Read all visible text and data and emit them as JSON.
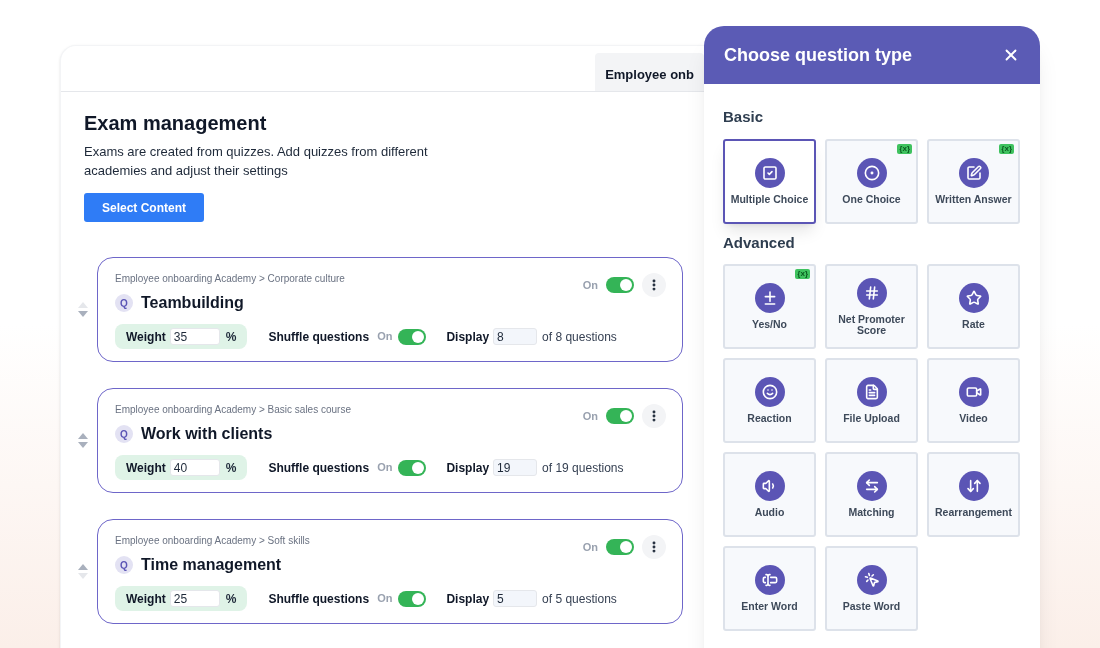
{
  "header": {
    "tab": "Employee onb"
  },
  "page": {
    "title": "Exam management",
    "description": "Exams are created from quizzes. Add quizzes from different academies and adjust their settings",
    "button": "Select Content"
  },
  "quizzes": [
    {
      "breadcrumb": "Employee onboarding Academy > Corporate culture",
      "badge": "Q",
      "title": "Teambuilding",
      "status_label": "On",
      "on": true,
      "weight_label": "Weight",
      "weight": "35",
      "weight_unit": "%",
      "shuffle_label": "Shuffle questions",
      "shuffle_state": "On",
      "shuffle": true,
      "display_label": "Display",
      "display": "8",
      "display_of": "of 8 questions",
      "move_up": false,
      "move_down": true
    },
    {
      "breadcrumb": "Employee onboarding Academy > Basic sales course",
      "badge": "Q",
      "title": "Work with clients",
      "status_label": "On",
      "on": true,
      "weight_label": "Weight",
      "weight": "40",
      "weight_unit": "%",
      "shuffle_label": "Shuffle questions",
      "shuffle_state": "On",
      "shuffle": true,
      "display_label": "Display",
      "display": "19",
      "display_of": "of 19 questions",
      "move_up": true,
      "move_down": true
    },
    {
      "breadcrumb": "Employee onboarding Academy > Soft skills",
      "badge": "Q",
      "title": "Time management",
      "status_label": "On",
      "on": true,
      "weight_label": "Weight",
      "weight": "25",
      "weight_unit": "%",
      "shuffle_label": "Shuffle questions",
      "shuffle_state": "On",
      "shuffle": true,
      "display_label": "Display",
      "display": "5",
      "display_of": "of 5 questions",
      "move_up": true,
      "move_down": false
    }
  ],
  "dialog": {
    "title": "Choose question type",
    "sections": [
      {
        "title": "Basic",
        "types": [
          {
            "label": "Multiple Choice",
            "kind": "checkbox",
            "selected": true
          },
          {
            "label": "One Choice",
            "kind": "radio",
            "selected": false,
            "badge": "{x}"
          },
          {
            "label": "Written Answer",
            "kind": "pencil",
            "selected": false,
            "badge": "{x}"
          }
        ]
      },
      {
        "title": "Advanced",
        "types": [
          {
            "label": "Yes/No",
            "kind": "plusminus",
            "selected": false,
            "badge": "{x}"
          },
          {
            "label": "Net Promoter Score",
            "kind": "score",
            "selected": false
          },
          {
            "label": "Rate",
            "kind": "star",
            "selected": false
          },
          {
            "label": "Reaction",
            "kind": "smile",
            "selected": false
          },
          {
            "label": "File Upload",
            "kind": "file",
            "selected": false
          },
          {
            "label": "Video",
            "kind": "video",
            "selected": false
          },
          {
            "label": "Audio",
            "kind": "audio",
            "selected": false
          },
          {
            "label": "Matching",
            "kind": "arrows",
            "selected": false
          },
          {
            "label": "Rearrangement",
            "kind": "reorder",
            "selected": false
          },
          {
            "label": "Enter Word",
            "kind": "textcursor",
            "selected": false
          },
          {
            "label": "Paste Word",
            "kind": "paste",
            "selected": false
          }
        ]
      }
    ]
  }
}
